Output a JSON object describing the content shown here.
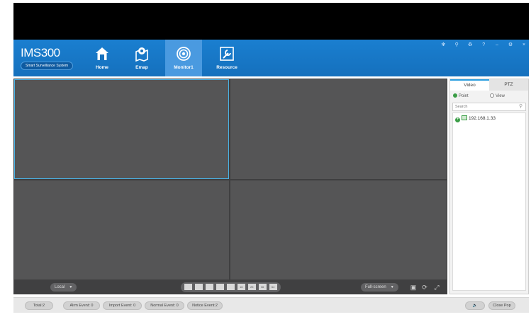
{
  "app": {
    "logo_title_main": "IMS",
    "logo_title_num": "300",
    "logo_subtitle": "Smart Survelliance System"
  },
  "nav": {
    "items": [
      {
        "label": "Home",
        "icon": "home-icon"
      },
      {
        "label": "Emap",
        "icon": "map-pin-icon"
      },
      {
        "label": "Monitor1",
        "icon": "camera-lens-icon",
        "active": true
      },
      {
        "label": "Resource",
        "icon": "wrench-icon"
      }
    ]
  },
  "window_controls": [
    "tree-icon",
    "lock-user-icon",
    "lock-icon",
    "?",
    "–",
    "settings-icon",
    "×"
  ],
  "window_controls_text": {
    "help": "?",
    "minimize": "–",
    "close": "×"
  },
  "video_toolbar": {
    "stream_select": "Local",
    "layout_buttons": [
      "1",
      "4",
      "6",
      "8",
      "9",
      "16",
      "25",
      "36",
      "64"
    ],
    "layout_labels": {
      "l16": "16",
      "l25": "25",
      "l36": "36",
      "l64": "64"
    },
    "fullscreen_select": "Full-screen"
  },
  "right_panel": {
    "tabs": [
      "Video",
      "PTZ"
    ],
    "radio_point": "Point",
    "radio_view": "View",
    "selected_radio": "Point",
    "search_placeholder": "Search",
    "tree": [
      {
        "label": "192.168.1.33"
      }
    ]
  },
  "status_bar": {
    "total": "Total:2",
    "alarm": "Alrm Event: 0",
    "import": "Import Event: 0",
    "normal": "Normal Event: 0",
    "notice": "Notice Event:2",
    "close_pop": "Close Pop"
  },
  "colors": {
    "appbar": "#1570bd",
    "active_nav": "#4a9ae0",
    "video_bg": "#555556",
    "selected_cell_border": "#4ab3e6",
    "accent_green": "#3a9d46"
  }
}
